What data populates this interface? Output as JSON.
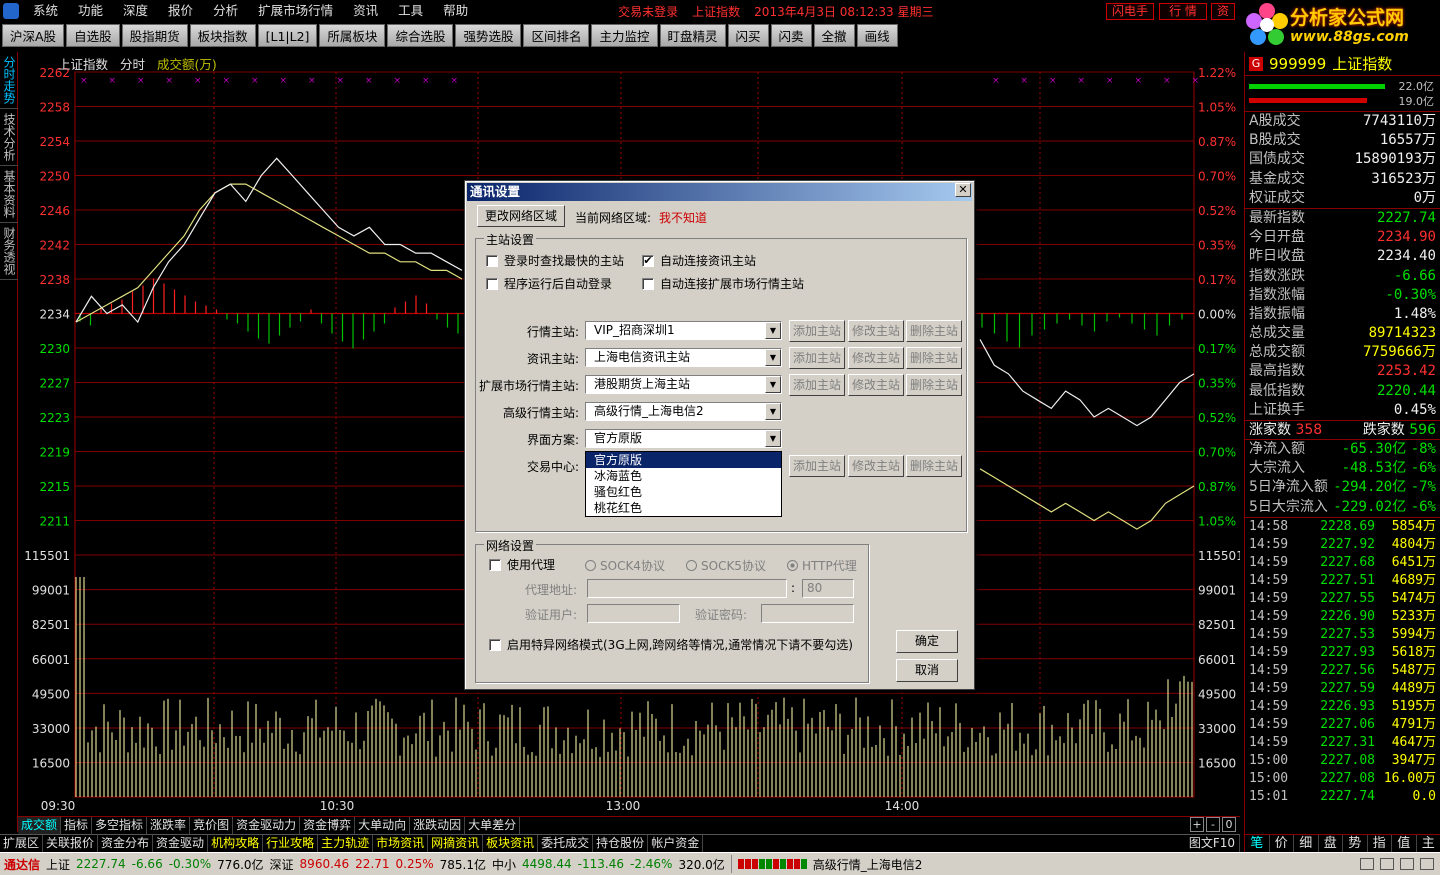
{
  "menu": {
    "items": [
      "系统",
      "功能",
      "深度",
      "报价",
      "分析",
      "扩展市场行情",
      "资讯",
      "工具",
      "帮助"
    ],
    "status1": "交易未登录",
    "status2": "上证指数",
    "datetime": "2013年4月3日  08:12:33  星期三",
    "btn_flash": "闪电手",
    "btn_quote": "行 情",
    "btn_info": "资"
  },
  "brand": {
    "name": "分析家公式网",
    "url": "www.88gs.com"
  },
  "toolbar": [
    "沪深A股",
    "自选股",
    "股指期货",
    "板块指数",
    "[L1|L2]",
    "所属板块",
    "综合选股",
    "强势选股",
    "区间排名",
    "主力监控",
    "盯盘精灵",
    "闪买",
    "闪卖",
    "全撤",
    "画线"
  ],
  "left_tabs": [
    "分时走势",
    "技术分析",
    "基本资料",
    "财务透视"
  ],
  "chart": {
    "title": "上证指数",
    "mode": "分时",
    "vol_label": "成交额(万)"
  },
  "chart_data": {
    "type": "line",
    "title": "上证指数",
    "x_ticks": [
      "09:30",
      "10:30",
      "13:00",
      "14:00"
    ],
    "price_ticks": [
      "2262",
      "2258",
      "2254",
      "2250",
      "2246",
      "2242",
      "2238",
      "2234",
      "2230",
      "2227",
      "2223",
      "2219",
      "2215",
      "2211"
    ],
    "pct_ticks": [
      "1.22%",
      "1.05%",
      "0.87%",
      "0.70%",
      "0.52%",
      "0.35%",
      "0.17%",
      "0.00%",
      "0.17%",
      "0.35%",
      "0.52%",
      "0.70%",
      "0.87%",
      "1.05%"
    ],
    "vol_ticks": [
      "115501",
      "99001",
      "82501",
      "66001",
      "49500",
      "33000",
      "16500"
    ],
    "prev_close": 2234.4,
    "price_range": [
      2211,
      2262
    ],
    "price_series_visible_left": [
      2234,
      2237,
      2235,
      2236,
      2234,
      2238,
      2241,
      2243,
      2246,
      2249,
      2250,
      2248,
      2251,
      2253,
      2251,
      2249,
      2247,
      2245,
      2244,
      2245,
      2243,
      2243,
      2242,
      2242,
      2241,
      2240
    ],
    "avg_series_visible_left": [
      2234,
      2235,
      2236,
      2237,
      2238,
      2240,
      2242,
      2244,
      2247,
      2249,
      2250,
      2250,
      2249,
      2248,
      2247,
      2246,
      2245,
      2244,
      2243,
      2242,
      2242,
      2241,
      2241,
      2240,
      2240,
      2239
    ],
    "price_series_visible_right": [
      2232,
      2229,
      2228,
      2226,
      2225,
      2224,
      2226,
      2225,
      2223,
      2224,
      2223,
      2222,
      2223,
      2225,
      2227,
      2228
    ],
    "avg_series_visible_right": [
      2217,
      2216,
      2215,
      2214,
      2213,
      2212,
      2213,
      2212,
      2211,
      2212,
      2211,
      2210,
      2211,
      2213,
      2214,
      2215
    ]
  },
  "bottom_tabs": [
    "成交额",
    "指标",
    "多空指标",
    "涨跌率",
    "竞价图",
    "资金驱动力",
    "资金博弈",
    "大单动向",
    "涨跌动因",
    "大单差分"
  ],
  "bottom_ctrl": [
    "+",
    "-",
    "0"
  ],
  "info_tabs": [
    "扩展区",
    "关联报价",
    "资金分布",
    "资金驱动",
    "机构攻略",
    "行业攻略",
    "主力轨迹",
    "市场资讯",
    "网摘资讯",
    "板块资讯",
    "委托成交",
    "持仓股份",
    "帐户资金"
  ],
  "info_right": "图文F10",
  "statusbar": {
    "app": "通达信",
    "sh_label": "上证",
    "sh_price": "2227.74",
    "sh_chg": "-6.66",
    "sh_pct": "-0.30%",
    "sh_amt": "776.0亿",
    "sz_label": "深证",
    "sz_price": "8960.46",
    "sz_chg": "22.71",
    "sz_pct": "0.25%",
    "sz_amt": "785.1亿",
    "zx_label": "中小",
    "zx_price": "4498.44",
    "zx_chg": "-113.46",
    "zx_pct": "-2.46%",
    "zx_amt": "320.0亿",
    "server": "高级行情_上海电信2"
  },
  "right_panel": {
    "code": "999999",
    "name": "上证指数",
    "g": "G",
    "bar1": "22.0亿",
    "bar2": "19.0亿",
    "vol_rows": [
      {
        "l": "A股成交",
        "v": "7743110万"
      },
      {
        "l": "B股成交",
        "v": "16557万"
      },
      {
        "l": "国债成交",
        "v": "15890193万"
      },
      {
        "l": "基金成交",
        "v": "316523万"
      },
      {
        "l": "权证成交",
        "v": "0万"
      }
    ],
    "idx_rows": [
      {
        "l": "最新指数",
        "v": "2227.74",
        "c": "grn"
      },
      {
        "l": "今日开盘",
        "v": "2234.90",
        "c": "red"
      },
      {
        "l": "昨日收盘",
        "v": "2234.40",
        "c": "wht"
      },
      {
        "l": "指数涨跌",
        "v": "-6.66",
        "c": "grn"
      },
      {
        "l": "指数涨幅",
        "v": "-0.30%",
        "c": "grn"
      },
      {
        "l": "指数振幅",
        "v": "1.48%",
        "c": "wht"
      },
      {
        "l": "总成交量",
        "v": "89714323",
        "c": "yel"
      },
      {
        "l": "总成交额",
        "v": "7759666万",
        "c": "yel"
      },
      {
        "l": "最高指数",
        "v": "2253.42",
        "c": "red"
      },
      {
        "l": "最低指数",
        "v": "2220.44",
        "c": "grn"
      },
      {
        "l": "上证换手",
        "v": "0.45%",
        "c": "wht"
      }
    ],
    "up_label": "涨家数",
    "up": "358",
    "down_label": "跌家数",
    "down": "596",
    "flow_rows": [
      {
        "l": "净流入额",
        "v": "-65.30亿",
        "p": "-8%"
      },
      {
        "l": "大宗流入",
        "v": "-48.53亿",
        "p": "-6%"
      },
      {
        "l": "5日净流入额",
        "v": "-294.20亿",
        "p": "-7%"
      },
      {
        "l": "5日大宗流入",
        "v": "-229.02亿",
        "p": "-6%"
      }
    ],
    "ticks": [
      [
        "14:58",
        "2228.69",
        "5854万"
      ],
      [
        "14:59",
        "2227.92",
        "4804万"
      ],
      [
        "14:59",
        "2227.68",
        "6451万"
      ],
      [
        "14:59",
        "2227.51",
        "4689万"
      ],
      [
        "14:59",
        "2227.55",
        "5474万"
      ],
      [
        "14:59",
        "2226.90",
        "5233万"
      ],
      [
        "14:59",
        "2227.53",
        "5994万"
      ],
      [
        "14:59",
        "2227.93",
        "5618万"
      ],
      [
        "14:59",
        "2227.56",
        "5487万"
      ],
      [
        "14:59",
        "2227.59",
        "4489万"
      ],
      [
        "14:59",
        "2226.93",
        "5195万"
      ],
      [
        "14:59",
        "2227.06",
        "4791万"
      ],
      [
        "14:59",
        "2227.31",
        "4647万"
      ],
      [
        "15:00",
        "2227.08",
        "3947万"
      ],
      [
        "15:00",
        "2227.08",
        "16.00万"
      ],
      [
        "15:01",
        "2227.74",
        "0.0"
      ]
    ],
    "tabs": [
      "笔",
      "价",
      "细",
      "盘",
      "势",
      "指",
      "值",
      "主"
    ]
  },
  "dialog": {
    "title": "通讯设置",
    "change_area": "更改网络区域",
    "cur_area_label": "当前网络区域:",
    "cur_area": "我不知道",
    "main_group": "主站设置",
    "cb1": "登录时查找最快的主站",
    "cb2": "自动连接资讯主站",
    "cb3": "程序运行后自动登录",
    "cb4": "自动连接扩展市场行情主站",
    "rows": [
      {
        "label": "行情主站:",
        "value": "VIP_招商深圳1"
      },
      {
        "label": "资讯主站:",
        "value": "上海电信资讯主站"
      },
      {
        "label": "扩展市场行情主站:",
        "value": "港股期货上海主站"
      },
      {
        "label": "高级行情主站:",
        "value": "高级行情_上海电信2"
      },
      {
        "label": "界面方案:",
        "value": "官方原版"
      },
      {
        "label": "交易中心:",
        "value": ""
      }
    ],
    "add": "添加主站",
    "edit": "修改主站",
    "del": "删除主站",
    "dropdown": [
      "官方原版",
      "冰海蓝色",
      "骚包红色",
      "桃花红色"
    ],
    "net_group": "网络设置",
    "use_proxy": "使用代理",
    "sock4": "SOCK4协议",
    "sock5": "SOCK5协议",
    "http": "HTTP代理",
    "proxy_addr": "代理地址:",
    "port": "80",
    "auth_user": "验证用户:",
    "auth_pwd": "验证密码:",
    "special": "启用特异网络模式(3G上网,跨网络等情况,通常情况下请不要勾选)",
    "ok": "确定",
    "cancel": "取消"
  }
}
